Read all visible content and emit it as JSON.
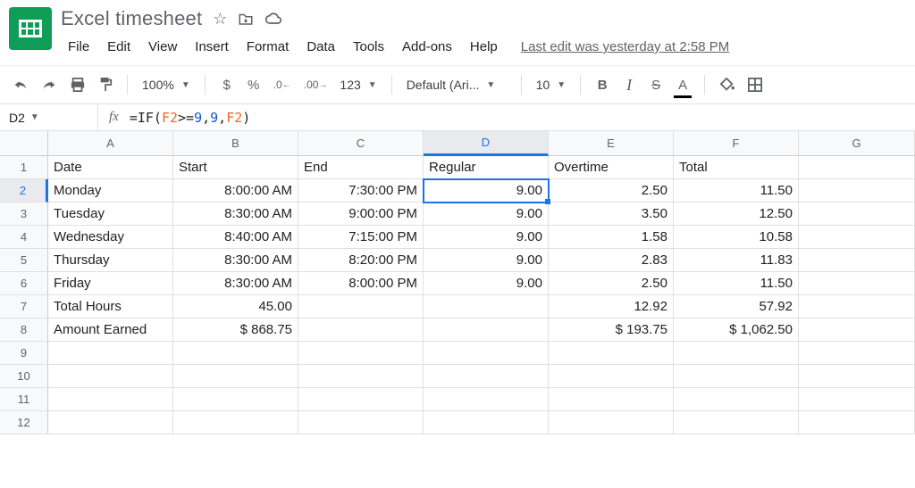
{
  "doc": {
    "title": "Excel timesheet"
  },
  "menus": [
    "File",
    "Edit",
    "View",
    "Insert",
    "Format",
    "Data",
    "Tools",
    "Add-ons",
    "Help"
  ],
  "last_edit": "Last edit was yesterday at 2:58 PM",
  "toolbar": {
    "zoom": "100%",
    "currency": "$",
    "percent": "%",
    "dec_less": ".0",
    "dec_more": ".00",
    "num_fmt": "123",
    "font": "Default (Ari...",
    "font_size": "10",
    "bold": "B",
    "italic": "I",
    "strike": "S",
    "text_color": "A"
  },
  "name_box": "D2",
  "formula_parts": {
    "p1": "=IF(",
    "r1": "F2",
    "p2": ">=",
    "n1": "9",
    "p3": ",",
    "n2": "9",
    "p4": ",",
    "r2": "F2",
    "p5": ")"
  },
  "columns": [
    "A",
    "B",
    "C",
    "D",
    "E",
    "F",
    "G"
  ],
  "rows": [
    "1",
    "2",
    "3",
    "4",
    "5",
    "6",
    "7",
    "8",
    "9",
    "10",
    "11",
    "12"
  ],
  "active": {
    "col": "D",
    "row": "2"
  },
  "cells": {
    "1": {
      "A": "Date",
      "B": "Start",
      "C": "End",
      "D": "Regular",
      "E": "Overtime",
      "F": "Total",
      "G": ""
    },
    "2": {
      "A": "Monday",
      "B": "8:00:00 AM",
      "C": "7:30:00 PM",
      "D": "9.00",
      "E": "2.50",
      "F": "11.50",
      "G": ""
    },
    "3": {
      "A": "Tuesday",
      "B": "8:30:00 AM",
      "C": "9:00:00 PM",
      "D": "9.00",
      "E": "3.50",
      "F": "12.50",
      "G": ""
    },
    "4": {
      "A": "Wednesday",
      "B": "8:40:00 AM",
      "C": "7:15:00 PM",
      "D": "9.00",
      "E": "1.58",
      "F": "10.58",
      "G": ""
    },
    "5": {
      "A": "Thursday",
      "B": "8:30:00 AM",
      "C": "8:20:00 PM",
      "D": "9.00",
      "E": "2.83",
      "F": "11.83",
      "G": ""
    },
    "6": {
      "A": "Friday",
      "B": "8:30:00 AM",
      "C": "8:00:00 PM",
      "D": "9.00",
      "E": "2.50",
      "F": "11.50",
      "G": ""
    },
    "7": {
      "A": "Total Hours",
      "B": "45.00",
      "C": "",
      "D": "",
      "E": "12.92",
      "F": "57.92",
      "G": ""
    },
    "8": {
      "A": "Amount Earned",
      "B": "$       868.75",
      "C": "",
      "D": "",
      "E": "$       193.75",
      "F": "$    1,062.50",
      "G": ""
    },
    "9": {
      "A": "",
      "B": "",
      "C": "",
      "D": "",
      "E": "",
      "F": "",
      "G": ""
    },
    "10": {
      "A": "",
      "B": "",
      "C": "",
      "D": "",
      "E": "",
      "F": "",
      "G": ""
    },
    "11": {
      "A": "",
      "B": "",
      "C": "",
      "D": "",
      "E": "",
      "F": "",
      "G": ""
    },
    "12": {
      "A": "",
      "B": "",
      "C": "",
      "D": "",
      "E": "",
      "F": "",
      "G": ""
    }
  },
  "align": {
    "A": "left",
    "B": "right",
    "C": "right",
    "D": "right",
    "E": "right",
    "F": "right",
    "G": "left",
    "header": "left"
  },
  "chart_data": {
    "type": "table",
    "title": "Excel timesheet",
    "columns": [
      "Date",
      "Start",
      "End",
      "Regular",
      "Overtime",
      "Total"
    ],
    "rows": [
      {
        "Date": "Monday",
        "Start": "8:00:00 AM",
        "End": "7:30:00 PM",
        "Regular": 9.0,
        "Overtime": 2.5,
        "Total": 11.5
      },
      {
        "Date": "Tuesday",
        "Start": "8:30:00 AM",
        "End": "9:00:00 PM",
        "Regular": 9.0,
        "Overtime": 3.5,
        "Total": 12.5
      },
      {
        "Date": "Wednesday",
        "Start": "8:40:00 AM",
        "End": "7:15:00 PM",
        "Regular": 9.0,
        "Overtime": 1.58,
        "Total": 10.58
      },
      {
        "Date": "Thursday",
        "Start": "8:30:00 AM",
        "End": "8:20:00 PM",
        "Regular": 9.0,
        "Overtime": 2.83,
        "Total": 11.83
      },
      {
        "Date": "Friday",
        "Start": "8:30:00 AM",
        "End": "8:00:00 PM",
        "Regular": 9.0,
        "Overtime": 2.5,
        "Total": 11.5
      }
    ],
    "totals": {
      "Regular_hours": 45.0,
      "Overtime_hours": 12.92,
      "Total_hours": 57.92
    },
    "amount_earned": {
      "Regular": 868.75,
      "Overtime": 193.75,
      "Total": 1062.5
    }
  }
}
